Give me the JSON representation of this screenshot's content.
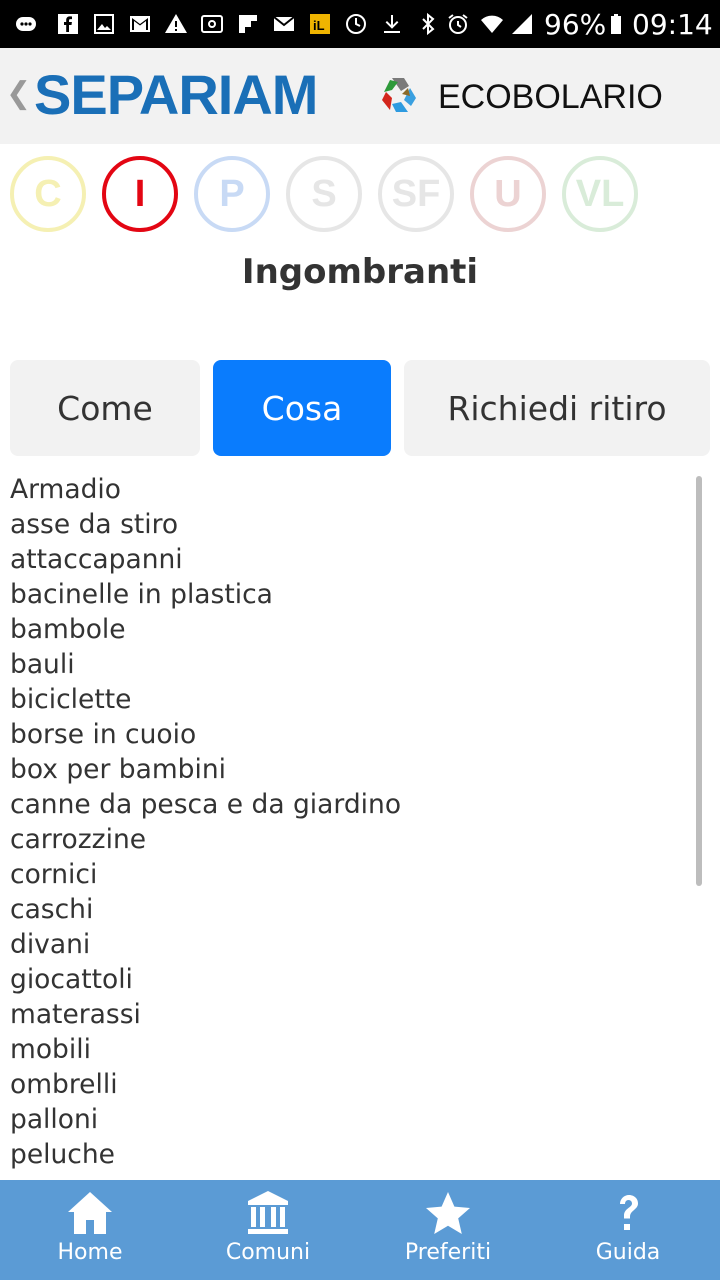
{
  "status_bar": {
    "battery": "96%",
    "time": "09:14"
  },
  "header": {
    "logo_text": "SEPARIAM",
    "title": "ECOBOLARIO"
  },
  "categories": [
    {
      "letter": "C",
      "color": "#f5f0b3"
    },
    {
      "letter": "I",
      "color": "#e30613"
    },
    {
      "letter": "P",
      "color": "#c8daf5"
    },
    {
      "letter": "S",
      "color": "#e6e6e6"
    },
    {
      "letter": "SF",
      "color": "#e6e6e6"
    },
    {
      "letter": "U",
      "color": "#ecd3d3"
    },
    {
      "letter": "VL",
      "color": "#d9ecd9"
    }
  ],
  "section_title": "Ingombranti",
  "tabs": [
    {
      "label": "Come",
      "active": false
    },
    {
      "label": "Cosa",
      "active": true
    },
    {
      "label": "Richiedi ritiro",
      "active": false
    }
  ],
  "items": [
    "Armadio",
    "asse da stiro",
    "attaccapanni",
    "bacinelle in plastica",
    "bambole",
    "bauli",
    "biciclette",
    "borse in cuoio",
    "box per bambini",
    "canne da pesca e da giardino",
    "carrozzine",
    "cornici",
    "caschi",
    "divani",
    "giocattoli",
    "materassi",
    "mobili",
    "ombrelli",
    "palloni",
    "peluche"
  ],
  "bottom_nav": [
    {
      "label": "Home",
      "icon": "home-icon"
    },
    {
      "label": "Comuni",
      "icon": "town-hall-icon"
    },
    {
      "label": "Preferiti",
      "icon": "star-icon"
    },
    {
      "label": "Guida",
      "icon": "question-icon"
    }
  ],
  "colors": {
    "accent": "#0a7cfd",
    "brand": "#1a6fb7",
    "nav_bg": "#5b9bd5"
  }
}
